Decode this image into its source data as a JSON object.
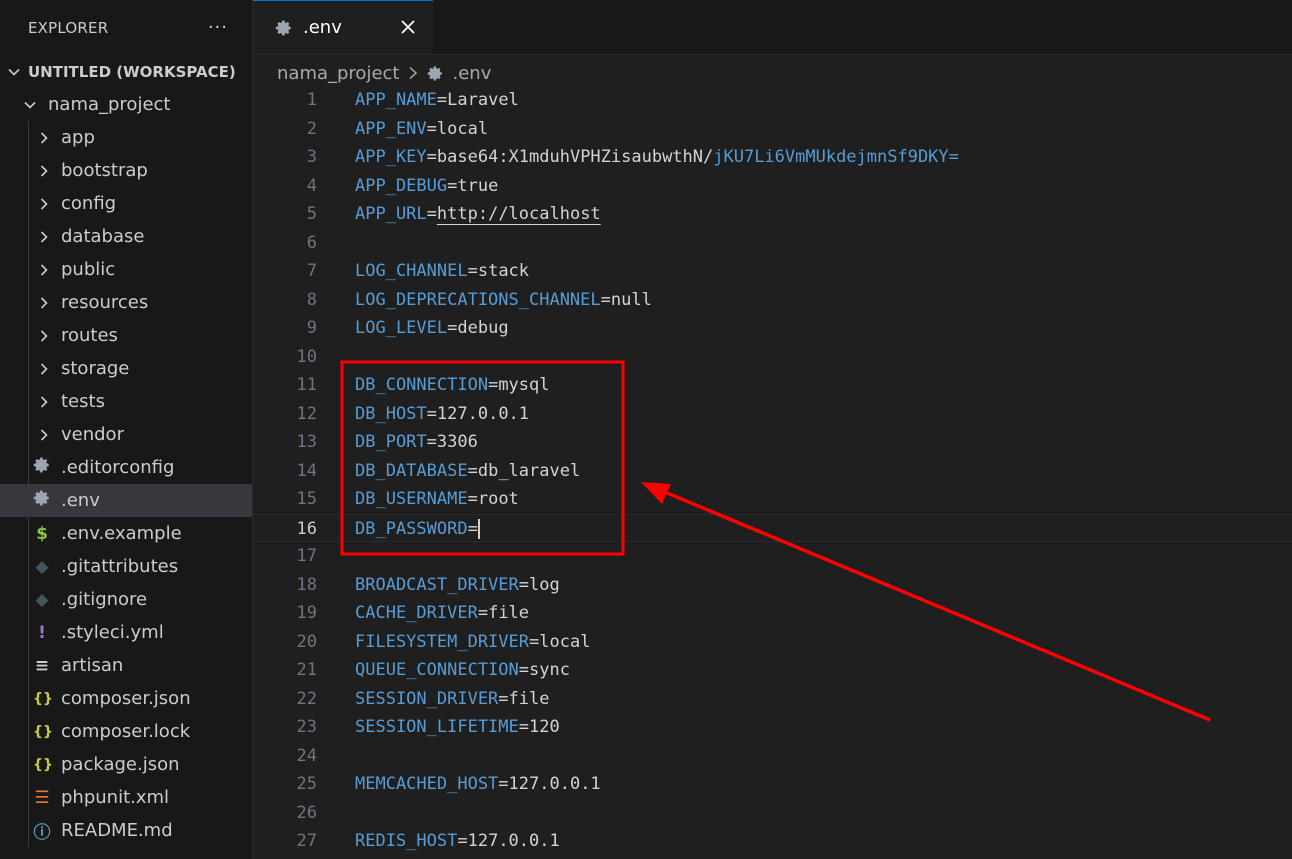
{
  "sidebar": {
    "title": "EXPLORER",
    "more_label": "···",
    "workspace": "UNTITLED (WORKSPACE)",
    "project": "nama_project",
    "folders": [
      "app",
      "bootstrap",
      "config",
      "database",
      "public",
      "resources",
      "routes",
      "storage",
      "tests",
      "vendor"
    ],
    "files": [
      {
        "name": ".editorconfig",
        "icon": "gear-icon",
        "glyph": "",
        "color": "#9da5b4"
      },
      {
        "name": ".env",
        "icon": "gear-icon",
        "glyph": "",
        "color": "#9da5b4",
        "active": true
      },
      {
        "name": ".env.example",
        "icon": "dollar-icon",
        "glyph": "$",
        "color": "#8dc149"
      },
      {
        "name": ".gitattributes",
        "icon": "git-icon",
        "glyph": "◆",
        "color": "#41535b"
      },
      {
        "name": ".gitignore",
        "icon": "git-icon",
        "glyph": "◆",
        "color": "#41535b"
      },
      {
        "name": ".styleci.yml",
        "icon": "yaml-icon",
        "glyph": "!",
        "color": "#a074c4"
      },
      {
        "name": "artisan",
        "icon": "text-file-icon",
        "glyph": "≡",
        "color": "#cccccc"
      },
      {
        "name": "composer.json",
        "icon": "json-icon",
        "glyph": "{}",
        "color": "#cbcb41"
      },
      {
        "name": "composer.lock",
        "icon": "json-icon",
        "glyph": "{}",
        "color": "#cbcb41"
      },
      {
        "name": "package.json",
        "icon": "json-icon",
        "glyph": "{}",
        "color": "#cbcb41"
      },
      {
        "name": "phpunit.xml",
        "icon": "rss-icon",
        "glyph": "☰",
        "color": "#e37933"
      },
      {
        "name": "README.md",
        "icon": "info-icon",
        "glyph": "ⓘ",
        "color": "#519aba"
      }
    ]
  },
  "tab": {
    "label": ".env"
  },
  "breadcrumb": {
    "folder": "nama_project",
    "file": ".env"
  },
  "editor": {
    "current_line": 16,
    "lines": [
      {
        "n": "1",
        "key": "APP_NAME",
        "val": "Laravel"
      },
      {
        "n": "2",
        "key": "APP_ENV",
        "val": "local"
      },
      {
        "n": "3",
        "key": "APP_KEY",
        "val": "base64:X1mduhVPHZisaubwthN/",
        "val2": "jKU7Li6VmMUkdejmnSf9DKY="
      },
      {
        "n": "4",
        "key": "APP_DEBUG",
        "val": "true"
      },
      {
        "n": "5",
        "key": "APP_URL",
        "val": "http://localhost",
        "link": true
      },
      {
        "n": "6"
      },
      {
        "n": "7",
        "key": "LOG_CHANNEL",
        "val": "stack"
      },
      {
        "n": "8",
        "key": "LOG_DEPRECATIONS_CHANNEL",
        "val": "null"
      },
      {
        "n": "9",
        "key": "LOG_LEVEL",
        "val": "debug"
      },
      {
        "n": "10"
      },
      {
        "n": "11",
        "key": "DB_CONNECTION",
        "val": "mysql"
      },
      {
        "n": "12",
        "key": "DB_HOST",
        "val": "127.0.0.1"
      },
      {
        "n": "13",
        "key": "DB_PORT",
        "val": "3306"
      },
      {
        "n": "14",
        "key": "DB_DATABASE",
        "val": "db_laravel"
      },
      {
        "n": "15",
        "key": "DB_USERNAME",
        "val": "root"
      },
      {
        "n": "16",
        "key": "DB_PASSWORD",
        "val": ""
      },
      {
        "n": "17"
      },
      {
        "n": "18",
        "key": "BROADCAST_DRIVER",
        "val": "log"
      },
      {
        "n": "19",
        "key": "CACHE_DRIVER",
        "val": "file"
      },
      {
        "n": "20",
        "key": "FILESYSTEM_DRIVER",
        "val": "local"
      },
      {
        "n": "21",
        "key": "QUEUE_CONNECTION",
        "val": "sync"
      },
      {
        "n": "22",
        "key": "SESSION_DRIVER",
        "val": "file"
      },
      {
        "n": "23",
        "key": "SESSION_LIFETIME",
        "val": "120"
      },
      {
        "n": "24"
      },
      {
        "n": "25",
        "key": "MEMCACHED_HOST",
        "val": "127.0.0.1"
      },
      {
        "n": "26"
      },
      {
        "n": "27",
        "key": "REDIS_HOST",
        "val": "127.0.0.1"
      }
    ]
  },
  "colors": {
    "key": "#569cd6",
    "value": "#d4d4d4",
    "highlight": "#ff0000",
    "accent": "#0078d4"
  }
}
